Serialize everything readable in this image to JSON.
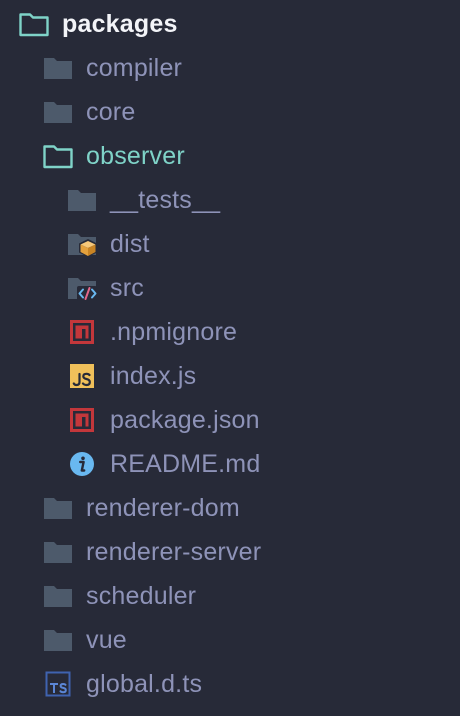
{
  "tree": {
    "root": {
      "label": "packages"
    },
    "folders": {
      "compiler": "compiler",
      "core": "core",
      "observer": "observer",
      "renderer_dom": "renderer-dom",
      "renderer_server": "renderer-server",
      "scheduler": "scheduler",
      "vue": "vue"
    },
    "observer_children": {
      "tests": "__tests__",
      "dist": "dist",
      "src": "src",
      "npmignore": ".npmignore",
      "index_js": "index.js",
      "package_json": "package.json",
      "readme": "README.md"
    },
    "files": {
      "global_d_ts": "global.d.ts"
    }
  },
  "icons": {
    "open_folder": "folder-open-icon",
    "closed_folder": "folder-icon",
    "dist": "folder-dist-icon",
    "src": "folder-src-icon",
    "npm": "npm-icon",
    "js": "javascript-icon",
    "info": "info-icon",
    "ts": "typescript-icon"
  },
  "colors": {
    "background": "#272a38",
    "label": "#8e93b8",
    "open_label": "#7fd3c8",
    "root_label": "#f3f4f8",
    "folder": "#4d5a6b",
    "open_folder": "#7fd3c8",
    "npm": "#c3373b",
    "js": "#f0c05a",
    "info": "#69b8f0",
    "ts": "#3f63b0"
  }
}
